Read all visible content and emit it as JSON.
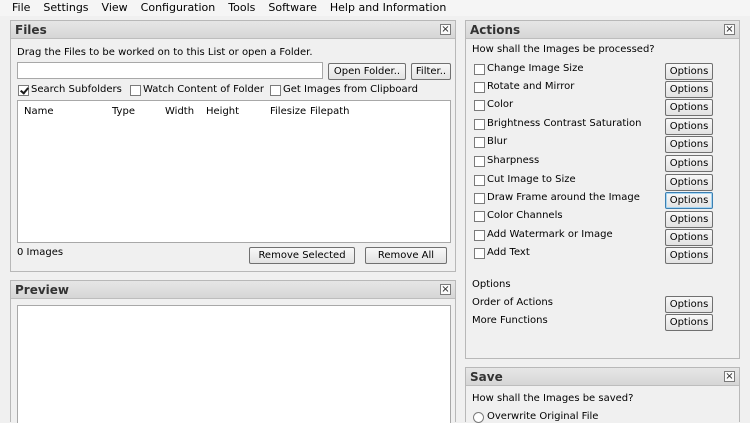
{
  "menu": [
    "File",
    "Settings",
    "View",
    "Configuration",
    "Tools",
    "Software",
    "Help and Information"
  ],
  "files": {
    "title": "Files",
    "drag_hint": "Drag the Files to be worked on to this List or open a Folder.",
    "path_value": "",
    "open_folder": "Open Folder..",
    "filter": "Filter..",
    "search_subfolders": "Search Subfolders",
    "watch_content": "Watch Content of Folder",
    "get_clipboard": "Get Images from Clipboard",
    "columns": [
      "Name",
      "Type",
      "Width",
      "Height",
      "Filesize",
      "Filepath"
    ],
    "count": "0 Images",
    "remove_selected": "Remove Selected",
    "remove_all": "Remove All"
  },
  "preview": {
    "title": "Preview"
  },
  "actions": {
    "title": "Actions",
    "question": "How shall the Images be processed?",
    "items": [
      "Change Image Size",
      "Rotate and Mirror",
      "Color",
      "Brightness Contrast Saturation",
      "Blur",
      "Sharpness",
      "Cut Image to Size",
      "Draw Frame around the Image",
      "Color Channels",
      "Add Watermark or Image",
      "Add Text"
    ],
    "options_label": "Options",
    "options_heading": "Options",
    "order_of_actions": "Order of Actions",
    "more_functions": "More Functions"
  },
  "save": {
    "title": "Save",
    "question": "How shall the Images be saved?",
    "overwrite": "Overwrite Original File"
  }
}
